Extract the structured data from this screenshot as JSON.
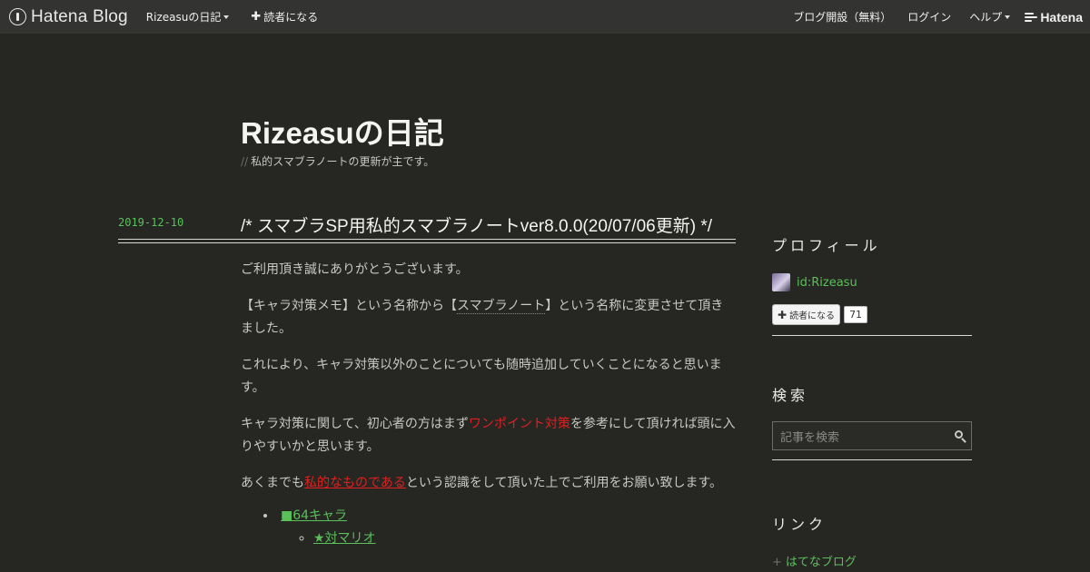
{
  "topbar": {
    "logo_text": "Hatena Blog",
    "blog_menu": "Rizeasuの日記",
    "subscribe": "読者になる",
    "open_blog": "ブログ開設（無料）",
    "login": "ログイン",
    "help": "ヘルプ",
    "hatena": "Hatena"
  },
  "header": {
    "title": "Rizeasuの日記",
    "description_prefix": "//",
    "description": "私的スマブラノートの更新が主です。"
  },
  "entry": {
    "date": "2019-12-10",
    "title": "/*  スマブラSP用私的スマブラノートver8.0.0(20/07/06更新)   */",
    "p1": "ご利用頂き誠にありがとうございます。",
    "p2_a": "【キャラ対策メモ】という名称から【",
    "p2_link": "スマブラノート",
    "p2_b": "】という名称に変更させて頂きました。",
    "p3": "これにより、キャラ対策以外のことについても随時追加していくことになると思います。",
    "p4_a": "キャラ対策に関して、初心者の方はまず",
    "p4_red": "ワンポイント対策",
    "p4_b": "を参考にして頂ければ頭に入りやすいかと思います。",
    "p5_a": "あくまでも",
    "p5_red": "私的なものである",
    "p5_b": "という認識をして頂いた上でご利用をお願い致します。",
    "list_item": "■64キャラ",
    "sub_item": "★対マリオ"
  },
  "sidebar": {
    "profile_heading": "プロフィール",
    "profile_id": "id:Rizeasu",
    "subscribe_label": "読者になる",
    "subscriber_count": "71",
    "search_heading": "検索",
    "search_placeholder": "記事を検索",
    "links_heading": "リンク",
    "link_plus": "+",
    "link_1": "はてなブログ"
  },
  "colors": {
    "background": "#262622",
    "topbar": "#333331",
    "accent_green": "#5ac05a",
    "accent_red": "#e02020"
  }
}
